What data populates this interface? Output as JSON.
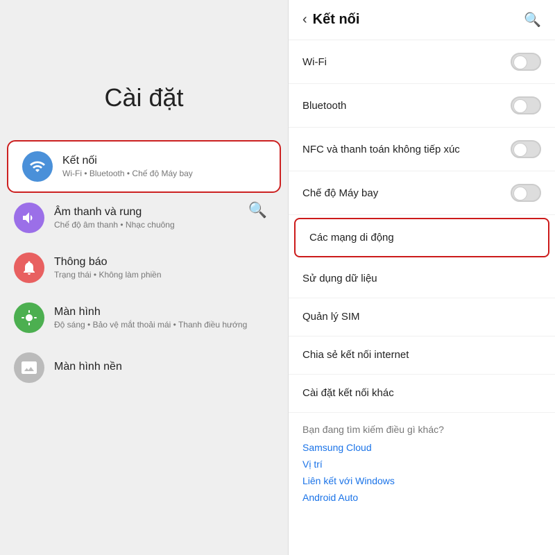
{
  "left": {
    "title": "Cài đặt",
    "items": [
      {
        "id": "ket-noi",
        "icon": "wifi",
        "title": "Kết nối",
        "subtitle": "Wi-Fi • Bluetooth • Chế độ Máy bay",
        "highlighted": true
      },
      {
        "id": "am-thanh",
        "icon": "sound",
        "title": "Âm thanh và rung",
        "subtitle": "Chế độ âm thanh • Nhạc chuông",
        "highlighted": false
      },
      {
        "id": "thong-bao",
        "icon": "notif",
        "title": "Thông báo",
        "subtitle": "Trạng thái • Không làm phiền",
        "highlighted": false
      },
      {
        "id": "man-hinh",
        "icon": "display",
        "title": "Màn hình",
        "subtitle": "Độ sáng • Bảo vệ mắt thoải mái • Thanh điều hướng",
        "highlighted": false
      },
      {
        "id": "man-hinh-nen",
        "icon": "wallpaper",
        "title": "Màn hình nền",
        "subtitle": "",
        "highlighted": false
      }
    ]
  },
  "right": {
    "header": {
      "back_label": "‹",
      "title": "Kết nối",
      "search_icon": "🔍"
    },
    "menu_items": [
      {
        "id": "wifi",
        "label": "Wi-Fi",
        "has_toggle": true,
        "active": false
      },
      {
        "id": "bluetooth",
        "label": "Bluetooth",
        "has_toggle": true,
        "active": false
      },
      {
        "id": "nfc",
        "label": "NFC và thanh toán không tiếp xúc",
        "has_toggle": true,
        "active": false
      },
      {
        "id": "may-bay",
        "label": "Chế độ Máy bay",
        "has_toggle": true,
        "active": false
      },
      {
        "id": "cac-mang-di-dong",
        "label": "Các mạng di động",
        "has_toggle": false,
        "highlighted": true,
        "active": false
      },
      {
        "id": "su-dung-du-lieu",
        "label": "Sử dụng dữ liệu",
        "has_toggle": false,
        "active": false
      },
      {
        "id": "quan-ly-sim",
        "label": "Quản lý SIM",
        "has_toggle": false,
        "active": false
      },
      {
        "id": "chia-se",
        "label": "Chia sẻ kết nối internet",
        "has_toggle": false,
        "active": false
      },
      {
        "id": "cai-dat-khac",
        "label": "Cài đặt kết nối khác",
        "has_toggle": false,
        "active": false
      }
    ],
    "suggestion_section": {
      "title": "Bạn đang tìm kiếm điều gì khác?",
      "links": [
        "Samsung Cloud",
        "Vị trí",
        "Liên kết với Windows",
        "Android Auto"
      ]
    }
  }
}
